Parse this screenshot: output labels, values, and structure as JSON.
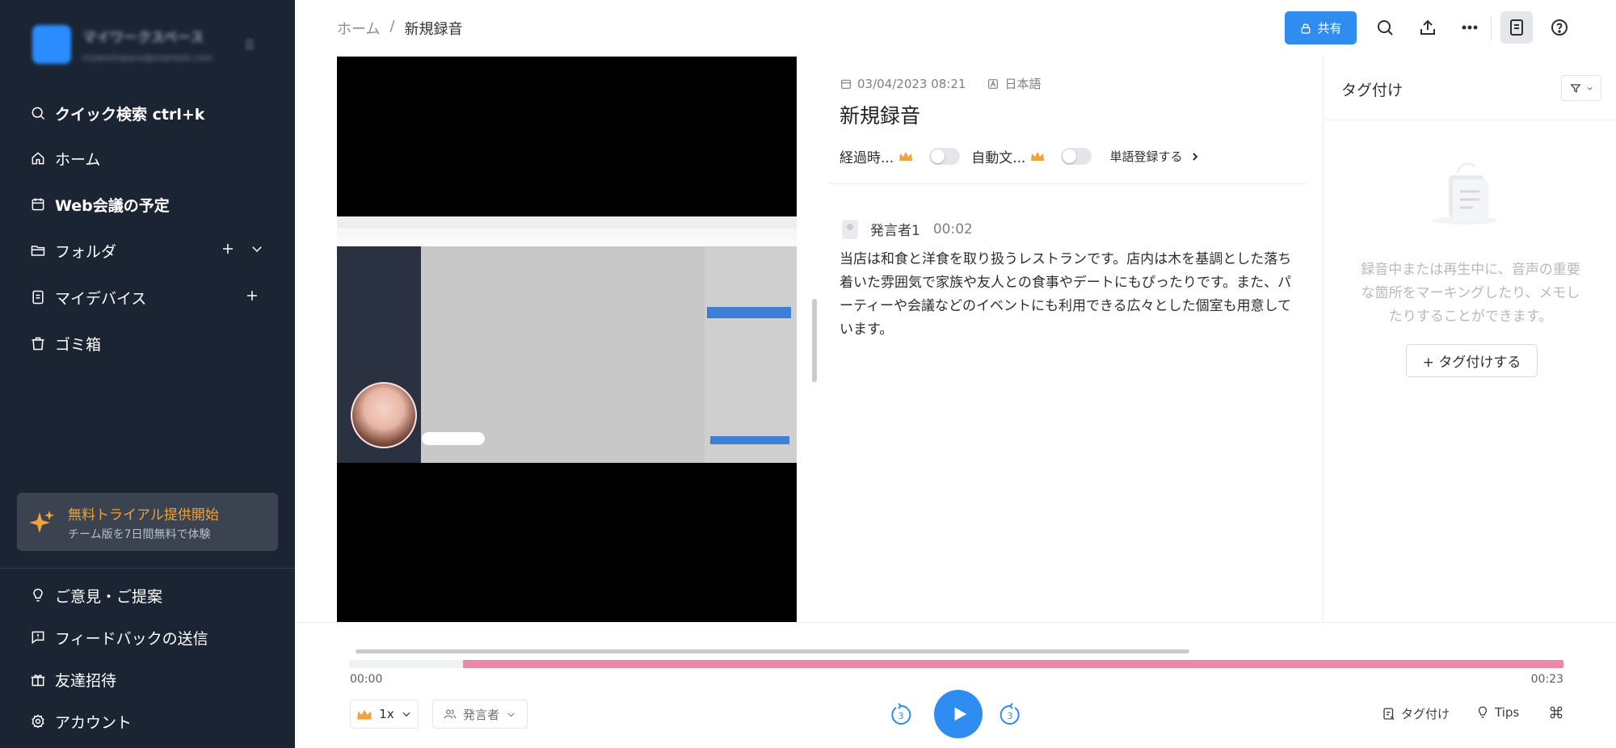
{
  "sidebar": {
    "workspace": {
      "name": "マイワークスペース",
      "sub": "myworkspace@example.com"
    },
    "items": [
      {
        "label": "クイック検索 ctrl+k"
      },
      {
        "label": "ホーム"
      },
      {
        "label": "Web会議の予定"
      },
      {
        "label": "フォルダ"
      },
      {
        "label": "マイデバイス"
      },
      {
        "label": "ゴミ箱"
      }
    ],
    "trial": {
      "title": "無料トライアル提供開始",
      "subtitle": "チーム版を7日間無料で体験"
    },
    "bottom": [
      {
        "label": "ご意見・ご提案"
      },
      {
        "label": "フィードバックの送信"
      },
      {
        "label": "友達招待"
      },
      {
        "label": "アカウント"
      }
    ]
  },
  "header": {
    "breadcrumb": {
      "home": "ホーム",
      "separator": "/",
      "current": "新規録音"
    },
    "share_label": "共有"
  },
  "recording": {
    "date": "03/04/2023 08:21",
    "language": "日本語",
    "title": "新規録音",
    "option_elapsed": "経過時...",
    "option_auto": "自動文...",
    "word_register": "単語登録する"
  },
  "transcript": [
    {
      "speaker": "発言者1",
      "time": "00:02",
      "text": "当店は和食と洋食を取り扱うレストランです。店内は木を基調とした落ち着いた雰囲気で家族や友人との食事やデートにもぴったりです。また、パーティーや会議などのイベントにも利用できる広々とした個室も用意しています。"
    }
  ],
  "tags": {
    "title": "タグ付け",
    "empty_text": "録音中または再生中に、音声の重要な箇所をマーキングしたり、メモしたりすることができます。",
    "add_label": "+ タグ付けする"
  },
  "player": {
    "current_time": "00:00",
    "total_time": "00:23",
    "progress_start_fraction": 0.094,
    "speed": "1x",
    "speaker_filter": "発言者",
    "skip_back": "3",
    "skip_forward": "3",
    "tag_label": "タグ付け",
    "tips_label": "Tips"
  },
  "colors": {
    "sidebar_bg": "#1b2433",
    "accent": "#2f8cf0",
    "progress": "#f087a6",
    "trial_title": "#f0a23b"
  }
}
